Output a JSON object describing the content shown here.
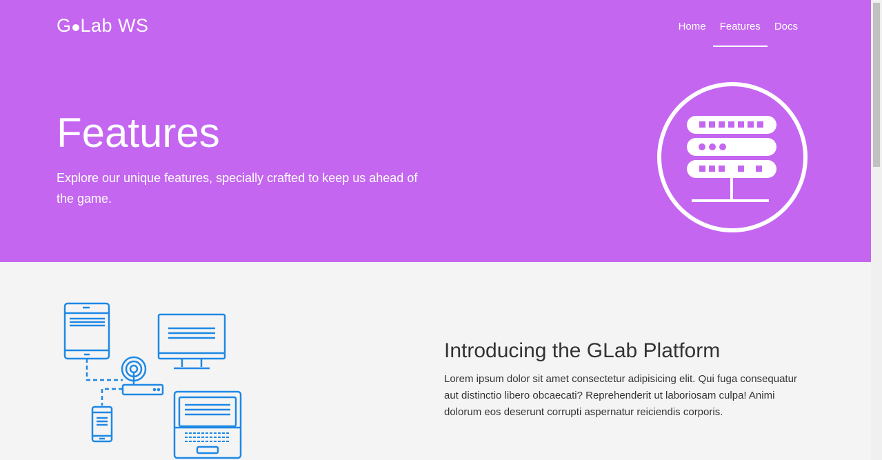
{
  "brand": {
    "name_prefix": "G",
    "name_suffix": "Lab WS"
  },
  "nav": {
    "items": [
      {
        "label": "Home",
        "active": false
      },
      {
        "label": "Features",
        "active": true
      },
      {
        "label": "Docs",
        "active": false
      }
    ]
  },
  "hero": {
    "title": "Features",
    "subtitle": "Explore our unique features, specially crafted to keep us ahead of the game.",
    "background_color": "#c466f0",
    "icon": "server-rack-icon"
  },
  "section": {
    "title": "Introducing the GLab Platform",
    "body": "Lorem ipsum dolor sit amet consectetur adipisicing elit. Qui fuga consequatur aut distinctio libero obcaecati? Reprehenderit ut laboriosam culpa! Animi dolorum eos deserunt corrupti aspernatur reiciendis corporis.",
    "illustration": "devices-network-icon",
    "accent_color": "#1e88e5"
  }
}
